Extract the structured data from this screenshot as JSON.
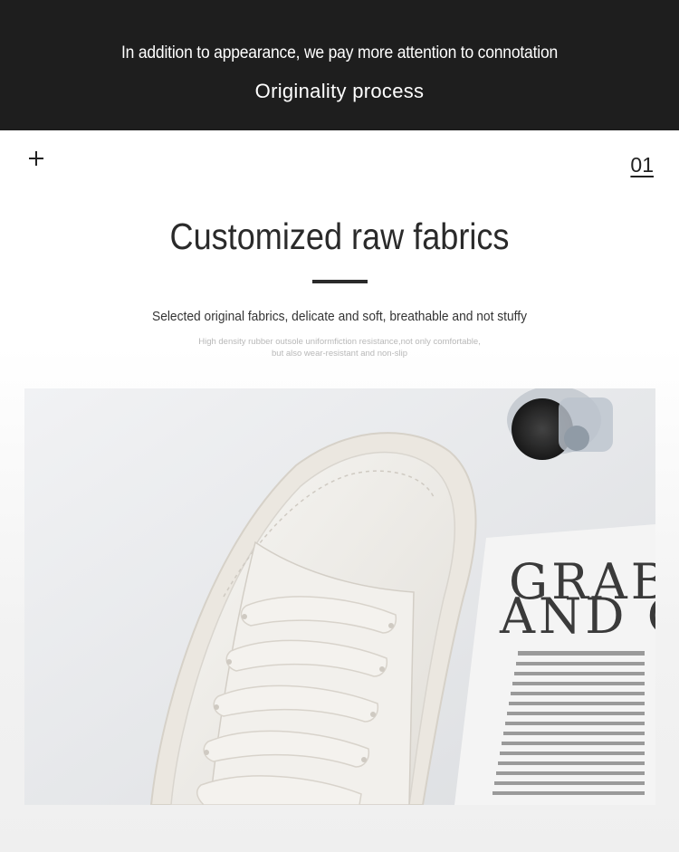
{
  "banner": {
    "subtitle": "In addition to appearance, we pay more attention to connotation",
    "title": "Originality process"
  },
  "section": {
    "number": "01",
    "icon": "plus-icon",
    "heading": "Customized raw fabrics",
    "tagline": "Selected original fabrics, delicate and soft, breathable and not stuffy",
    "detail_line1": "High density rubber outsole uniformfiction resistance,not only comfortable,",
    "detail_line2": "but also wear-resistant and non-slip"
  },
  "photo": {
    "magazine_line1": "GRAB",
    "magazine_line2": "AND C"
  },
  "colors": {
    "banner_bg": "#1e1e1e",
    "text_dark": "#2a2a2a",
    "text_light": "#b8b8b8"
  }
}
